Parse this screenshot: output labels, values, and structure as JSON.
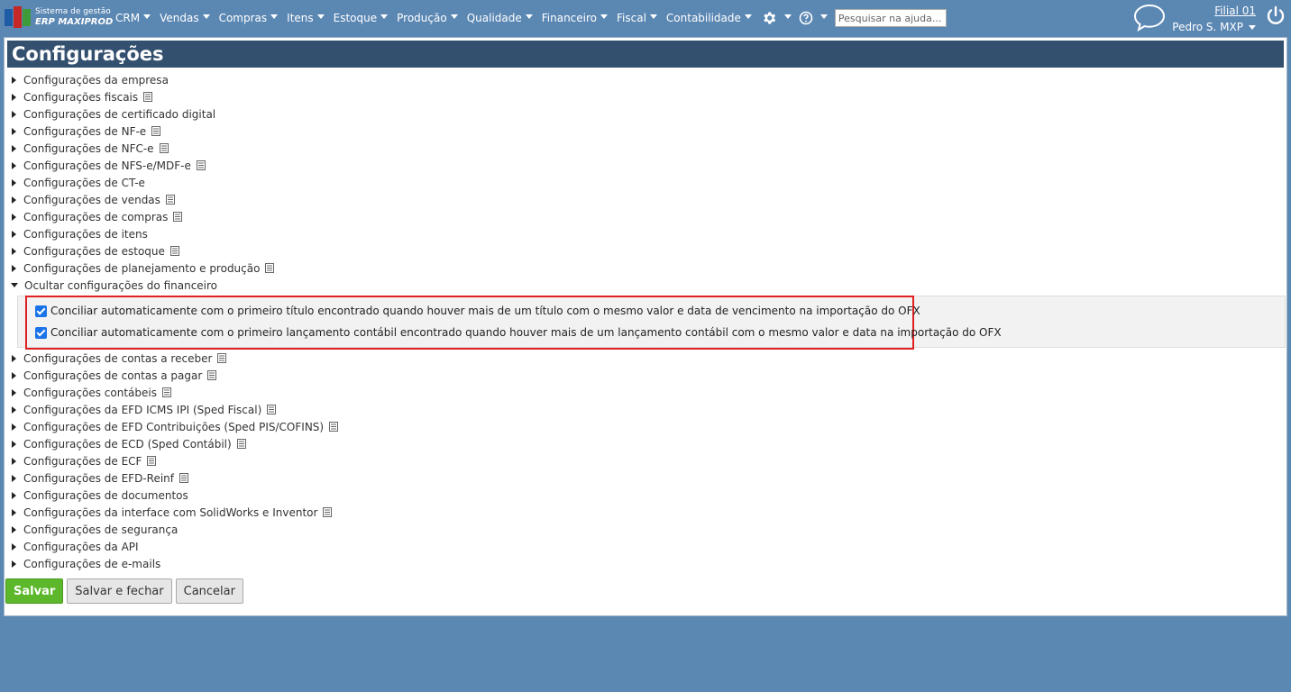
{
  "brand": {
    "line1": "Sistema de gestão",
    "line2": "ERP MAXIPROD"
  },
  "menu": [
    "CRM",
    "Vendas",
    "Compras",
    "Itens",
    "Estoque",
    "Produção",
    "Qualidade",
    "Financeiro",
    "Fiscal",
    "Contabilidade"
  ],
  "search": {
    "placeholder": "Pesquisar na ajuda..."
  },
  "account": {
    "branch": "Filial 01",
    "user": "Pedro S. MXP"
  },
  "page": {
    "title": "Configurações"
  },
  "sections_before": [
    {
      "label": "Configurações da empresa",
      "doc": false
    },
    {
      "label": "Configurações fiscais",
      "doc": true
    },
    {
      "label": "Configurações de certificado digital",
      "doc": false
    },
    {
      "label": "Configurações de NF-e",
      "doc": true
    },
    {
      "label": "Configurações de NFC-e",
      "doc": true
    },
    {
      "label": "Configurações de NFS-e/MDF-e",
      "doc": true
    },
    {
      "label": "Configurações de CT-e",
      "doc": false
    },
    {
      "label": "Configurações de vendas",
      "doc": true
    },
    {
      "label": "Configurações de compras",
      "doc": true
    },
    {
      "label": "Configurações de itens",
      "doc": false
    },
    {
      "label": "Configurações de estoque",
      "doc": true
    },
    {
      "label": "Configurações de planejamento e produção",
      "doc": true
    }
  ],
  "finance": {
    "toggle_label": "Ocultar configurações do financeiro",
    "options": [
      {
        "label": "Conciliar automaticamente com o primeiro título encontrado quando houver mais de um título com o mesmo valor e data de vencimento na importação do OFX",
        "checked": true
      },
      {
        "label": "Conciliar automaticamente com o primeiro lançamento contábil encontrado quando houver mais de um lançamento contábil com o mesmo valor e data na importação do OFX",
        "checked": true
      }
    ]
  },
  "sections_after": [
    {
      "label": "Configurações de contas a receber",
      "doc": true
    },
    {
      "label": "Configurações de contas a pagar",
      "doc": true
    },
    {
      "label": "Configurações contábeis",
      "doc": true
    },
    {
      "label": "Configurações da EFD ICMS IPI (Sped Fiscal)",
      "doc": true
    },
    {
      "label": "Configurações de EFD Contribuições (Sped PIS/COFINS)",
      "doc": true
    },
    {
      "label": "Configurações de ECD (Sped Contábil)",
      "doc": true
    },
    {
      "label": "Configurações de ECF",
      "doc": true
    },
    {
      "label": "Configurações de EFD-Reinf",
      "doc": true
    },
    {
      "label": "Configurações de documentos",
      "doc": false
    },
    {
      "label": "Configurações da interface com SolidWorks e Inventor",
      "doc": true
    },
    {
      "label": "Configurações de segurança",
      "doc": false
    },
    {
      "label": "Configurações da API",
      "doc": false
    },
    {
      "label": "Configurações de e-mails",
      "doc": false
    }
  ],
  "actions": {
    "save": "Salvar",
    "save_close": "Salvar e fechar",
    "cancel": "Cancelar"
  },
  "colors": {
    "background": "#5b87b3",
    "title_bar": "#34506f",
    "primary_button": "#5cb82a",
    "highlight": "#e02020",
    "checkbox": "#1a73e8"
  }
}
